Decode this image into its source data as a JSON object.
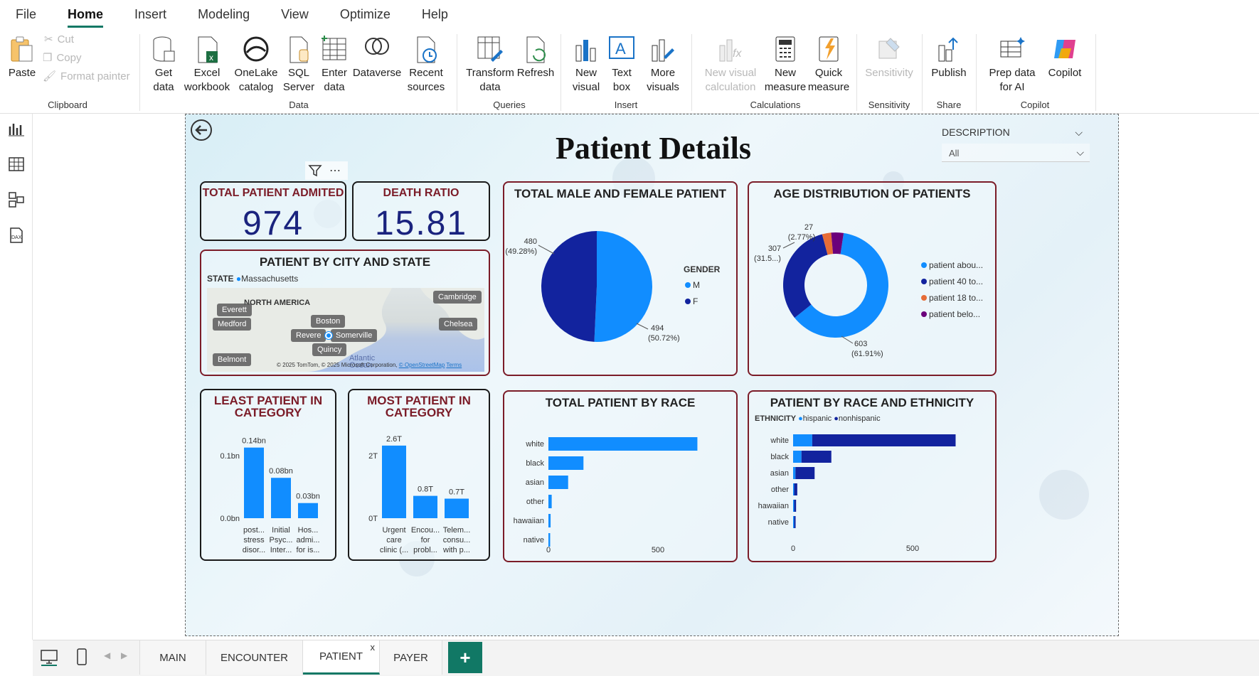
{
  "menu": [
    "File",
    "Home",
    "Insert",
    "Modeling",
    "View",
    "Optimize",
    "Help"
  ],
  "ribbon": {
    "clipboard": {
      "paste": "Paste",
      "cut": "Cut",
      "copy": "Copy",
      "format_painter": "Format painter",
      "group": "Clipboard"
    },
    "data": {
      "get_data": "Get data",
      "excel": "Excel workbook",
      "onelake": "OneLake catalog",
      "sql": "SQL Server",
      "enter_data": "Enter data",
      "dataverse": "Dataverse",
      "recent": "Recent sources",
      "group": "Data"
    },
    "queries": {
      "transform": "Transform data",
      "refresh": "Refresh",
      "group": "Queries"
    },
    "insert": {
      "new_visual": "New visual",
      "text_box": "Text box",
      "more_visuals": "More visuals",
      "group": "Insert"
    },
    "calculations": {
      "new_visual_calc": "New visual calculation",
      "new_measure": "New measure",
      "quick_measure": "Quick measure",
      "group": "Calculations"
    },
    "sensitivity": {
      "label": "Sensitivity",
      "group": "Sensitivity"
    },
    "share": {
      "publish": "Publish",
      "group": "Share"
    },
    "copilot": {
      "prep": "Prep data for AI",
      "copilot": "Copilot",
      "group": "Copilot"
    }
  },
  "report": {
    "title": "Patient Details",
    "slicer": {
      "label": "DESCRIPTION",
      "value": "All"
    },
    "kpi_admitted": {
      "title": "TOTAL PATIENT ADMITED",
      "value": "974"
    },
    "kpi_death": {
      "title": "DEATH RATIO",
      "value": "15.81"
    },
    "map": {
      "title": "PATIENT BY CITY AND STATE",
      "legend_title": "STATE",
      "legend_item": "Massachusetts",
      "region_label": "NORTH AMERICA",
      "ocean_label": "Atlantic Ocean",
      "cities": [
        "Everett",
        "Medford",
        "Boston",
        "Revere",
        "Somerville",
        "Quincy",
        "Belmont",
        "Cambridge",
        "Chelsea"
      ],
      "copyright": "© 2025 TomTom, © 2025 Microsoft Corporation,",
      "osm": "© OpenStreetMap",
      "terms": "Terms"
    },
    "gender": {
      "title": "TOTAL MALE AND FEMALE PATIENT",
      "legend_title": "GENDER",
      "legend": [
        "M",
        "F"
      ],
      "labels": [
        {
          "value": "480",
          "pct": "(49.28%)"
        },
        {
          "value": "494",
          "pct": "(50.72%)"
        }
      ]
    },
    "age": {
      "title": "AGE DISTRIBUTION OF PATIENTS",
      "legend": [
        "patient abou...",
        "patient 40 to...",
        "patient 18 to...",
        "patient belo..."
      ],
      "labels": [
        {
          "value": "27",
          "pct": "(2.77%)"
        },
        {
          "value": "307",
          "pct": "(31.5...)"
        },
        {
          "value": "603",
          "pct": "(61.91%)"
        }
      ]
    },
    "least": {
      "title": "LEAST PATIENT IN CATEGORY",
      "yticks": [
        "0.1bn",
        "0.0bn"
      ],
      "data_labels": [
        "0.14bn",
        "0.08bn",
        "0.03bn"
      ],
      "cats": [
        [
          "post...",
          "stress",
          "disor..."
        ],
        [
          "Initial",
          "Psyc...",
          "Inter..."
        ],
        [
          "Hos...",
          "admi...",
          "for is..."
        ]
      ]
    },
    "most": {
      "title": "MOST PATIENT IN CATEGORY",
      "yticks": [
        "2T",
        "0T"
      ],
      "data_labels": [
        "2.6T",
        "0.8T",
        "0.7T"
      ],
      "cats": [
        [
          "Urgent",
          "care",
          "clinic (..."
        ],
        [
          "Encou...",
          "for",
          "probl..."
        ],
        [
          "Telem...",
          "consu...",
          "with p..."
        ]
      ]
    },
    "race": {
      "title": "TOTAL PATIENT BY RACE",
      "xticks": [
        "0",
        "500"
      ]
    },
    "race_eth": {
      "title": "PATIENT BY RACE AND ETHNICITY",
      "legend_title": "ETHNICITY",
      "legend": [
        "hispanic",
        "nonhispanic"
      ],
      "xticks": [
        "0",
        "500"
      ]
    }
  },
  "tabs": [
    "MAIN",
    "ENCOUNTER",
    "PATIENT",
    "PAYER"
  ],
  "tab_close": "x",
  "colors": {
    "accent": "#117865",
    "blue": "#118DFF",
    "navy": "#12239E",
    "orange": "#E66C37",
    "purple": "#6B007B",
    "border_red": "#7b1c28"
  },
  "chart_data": [
    {
      "type": "pie",
      "title": "TOTAL MALE AND FEMALE PATIENT",
      "categories": [
        "M",
        "F"
      ],
      "values": [
        494,
        480
      ]
    },
    {
      "type": "pie",
      "title": "AGE DISTRIBUTION OF PATIENTS",
      "categories": [
        "patient abou...",
        "patient 40 to...",
        "patient 18 to...",
        "patient belo..."
      ],
      "values": [
        603,
        307,
        27,
        37
      ]
    },
    {
      "type": "bar",
      "title": "LEAST PATIENT IN CATEGORY",
      "categories": [
        "post stress disor...",
        "Initial Psyc Inter...",
        "Hos admi for is..."
      ],
      "values": [
        0.14,
        0.08,
        0.03
      ],
      "ylabel": "",
      "ylim": [
        0,
        0.15
      ]
    },
    {
      "type": "bar",
      "title": "MOST PATIENT IN CATEGORY",
      "categories": [
        "Urgent care clinic (...",
        "Encou for probl...",
        "Telem consu with p..."
      ],
      "values": [
        2.6,
        0.8,
        0.7
      ],
      "ylim": [
        0,
        3
      ]
    },
    {
      "type": "bar",
      "orientation": "horizontal",
      "title": "TOTAL PATIENT BY RACE",
      "categories": [
        "white",
        "black",
        "asian",
        "other",
        "hawaiian",
        "native"
      ],
      "values": [
        680,
        160,
        90,
        15,
        10,
        8
      ],
      "xlim": [
        0,
        1000
      ]
    },
    {
      "type": "bar",
      "orientation": "horizontal",
      "stacked": true,
      "title": "PATIENT BY RACE AND ETHNICITY",
      "categories": [
        "white",
        "black",
        "asian",
        "other",
        "hawaiian",
        "native"
      ],
      "series": [
        {
          "name": "hispanic",
          "values": [
            80,
            35,
            10,
            2,
            2,
            2
          ]
        },
        {
          "name": "nonhispanic",
          "values": [
            600,
            125,
            80,
            13,
            8,
            6
          ]
        }
      ],
      "xlim": [
        0,
        1000
      ]
    }
  ]
}
